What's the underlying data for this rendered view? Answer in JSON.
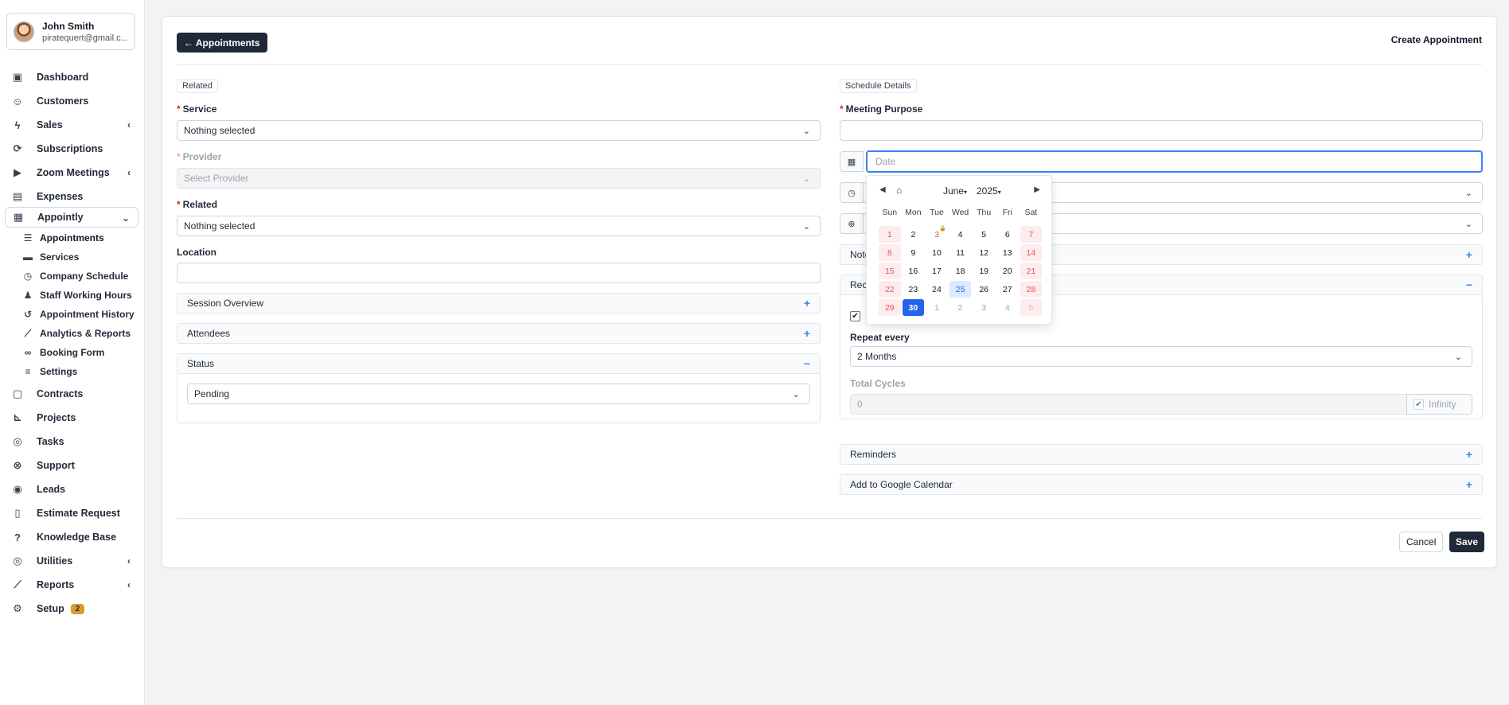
{
  "user": {
    "name": "John Smith",
    "email": "piratequert@gmail.c..."
  },
  "nav": {
    "dashboard": "Dashboard",
    "customers": "Customers",
    "sales": "Sales",
    "subscriptions": "Subscriptions",
    "zoom": "Zoom Meetings",
    "expenses": "Expenses",
    "appointly": "Appointly",
    "sub": {
      "appointments": "Appointments",
      "services": "Services",
      "company_schedule": "Company Schedule",
      "staff_hours": "Staff Working Hours",
      "history": "Appointment History",
      "analytics": "Analytics & Reports",
      "booking_form": "Booking Form",
      "settings": "Settings"
    },
    "contracts": "Contracts",
    "projects": "Projects",
    "tasks": "Tasks",
    "support": "Support",
    "leads": "Leads",
    "estimate": "Estimate Request",
    "kb": "Knowledge Base",
    "utilities": "Utilities",
    "reports": "Reports",
    "setup": "Setup",
    "setup_badge": "2"
  },
  "header": {
    "back_label": "← Appointments",
    "title": "Create Appointment"
  },
  "left": {
    "related_tag": "Related",
    "service_label": "Service",
    "service_value": "Nothing selected",
    "provider_label": "Provider",
    "provider_value": "Select Provider",
    "related_label": "Related",
    "related_value": "Nothing selected",
    "location_label": "Location",
    "session_overview": "Session Overview",
    "attendees": "Attendees",
    "status": "Status",
    "status_value": "Pending",
    "plus": "+",
    "minus": "−"
  },
  "right": {
    "schedule_tag": "Schedule Details",
    "meeting_purpose_label": "Meeting Purpose",
    "date_placeholder": "Date",
    "notes_partial": "Note",
    "recurring_partial": "Recu",
    "repeat_every_label": "Repeat every",
    "repeat_every_value": "2 Months",
    "total_cycles_label": "Total Cycles",
    "total_cycles_value": "0",
    "infinity_label": "Infinity",
    "reminders": "Reminders",
    "google": "Add to Google Calendar"
  },
  "footer": {
    "cancel": "Cancel",
    "save": "Save"
  },
  "datepicker": {
    "month": "June",
    "year": "2025",
    "weekdays": [
      "Sun",
      "Mon",
      "Tue",
      "Wed",
      "Thu",
      "Fri",
      "Sat"
    ],
    "days": [
      {
        "d": "1",
        "t": "weekend"
      },
      {
        "d": "2"
      },
      {
        "d": "3",
        "t": "holiday",
        "lock": true
      },
      {
        "d": "4"
      },
      {
        "d": "5"
      },
      {
        "d": "6"
      },
      {
        "d": "7",
        "t": "weekend"
      },
      {
        "d": "8",
        "t": "weekend"
      },
      {
        "d": "9"
      },
      {
        "d": "10"
      },
      {
        "d": "11"
      },
      {
        "d": "12"
      },
      {
        "d": "13"
      },
      {
        "d": "14",
        "t": "weekend"
      },
      {
        "d": "15",
        "t": "weekend"
      },
      {
        "d": "16"
      },
      {
        "d": "17"
      },
      {
        "d": "18"
      },
      {
        "d": "19"
      },
      {
        "d": "20"
      },
      {
        "d": "21",
        "t": "weekend"
      },
      {
        "d": "22",
        "t": "weekend"
      },
      {
        "d": "23"
      },
      {
        "d": "24"
      },
      {
        "d": "25",
        "t": "today"
      },
      {
        "d": "26"
      },
      {
        "d": "27"
      },
      {
        "d": "28",
        "t": "weekend"
      },
      {
        "d": "29",
        "t": "weekend"
      },
      {
        "d": "30",
        "t": "selected"
      },
      {
        "d": "1",
        "t": "other"
      },
      {
        "d": "2",
        "t": "other"
      },
      {
        "d": "3",
        "t": "other"
      },
      {
        "d": "4",
        "t": "other"
      },
      {
        "d": "5",
        "t": "weekend other"
      }
    ]
  },
  "colors": {
    "accent": "#2563eb",
    "dark": "#1f2937",
    "required": "#dc2626",
    "badge": "#d69e2e"
  }
}
